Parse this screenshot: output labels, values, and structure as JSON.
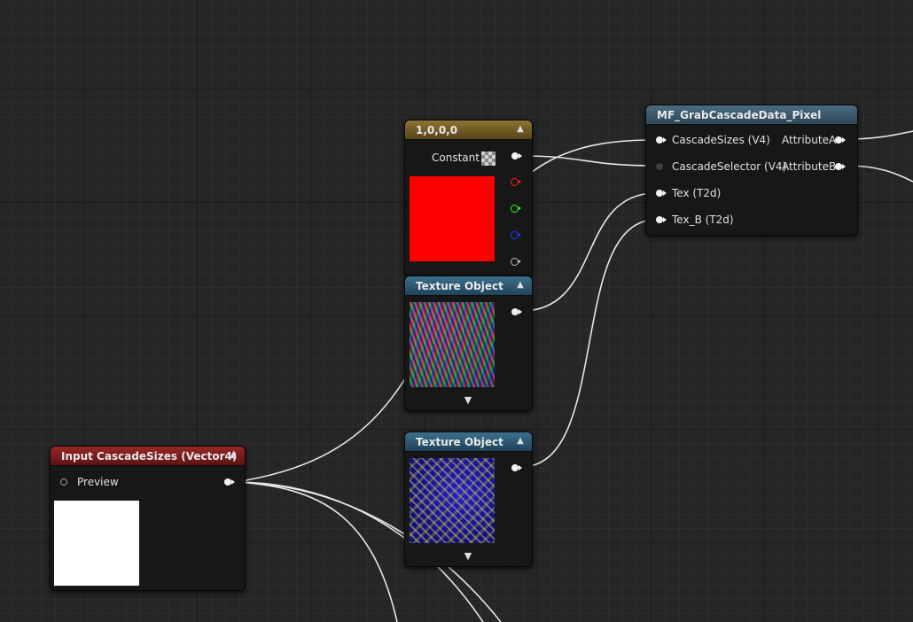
{
  "nodes": {
    "constant": {
      "title": "1,0,0,0",
      "label": "Constant",
      "preview_color": "#ff0000",
      "header_color": "#8c7431"
    },
    "texture_object_1": {
      "title": "Texture Object"
    },
    "texture_object_2": {
      "title": "Texture Object"
    },
    "input_cascade": {
      "title": "Input CascadeSizes (Vector4)",
      "pin_label": "Preview",
      "preview_color": "#ffffff",
      "header_color": "#982626"
    },
    "function": {
      "title": "MF_GrabCascadeData_Pixel",
      "inputs": [
        "CascadeSizes (V4)",
        "CascadeSelector (V4)",
        "Tex (T2d)",
        "Tex_B (T2d)"
      ],
      "outputs": [
        "AttributeA",
        "AttributeB"
      ]
    }
  },
  "icons": {
    "collapse": "chevron-up-icon",
    "expand": "chevron-down-icon"
  },
  "colors": {
    "wire": "#e6e6e6",
    "channel_r": "#ff2020",
    "channel_g": "#20ff20",
    "channel_b": "#2040ff",
    "channel_a": "#bbbbbb"
  }
}
